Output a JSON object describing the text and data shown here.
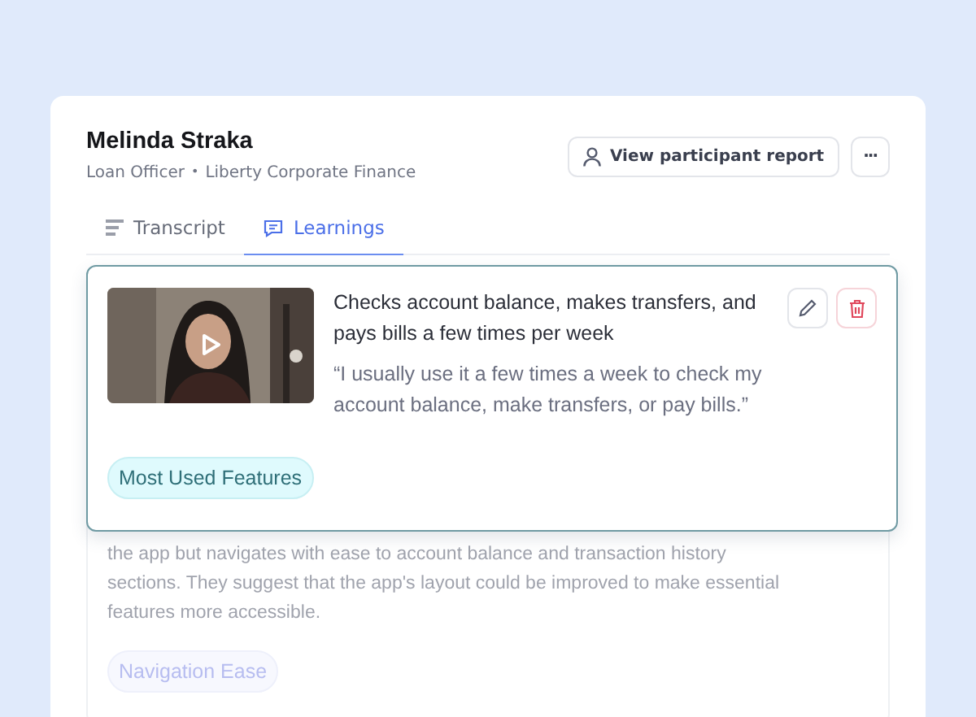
{
  "participant": {
    "name": "Melinda Straka",
    "role": "Loan Officer",
    "separator": "•",
    "company": "Liberty Corporate Finance"
  },
  "actions": {
    "report_button": "View participant report",
    "more_button": "···"
  },
  "tabs": [
    {
      "label": "Transcript",
      "selected": false,
      "kind": "transcript"
    },
    {
      "label": "Learnings",
      "selected": true,
      "kind": "learnings"
    }
  ],
  "learnings": [
    {
      "kind": "focused",
      "title": "Checks account balance, makes transfers, and pays bills a few times per week",
      "quote": "“I usually use it a few times a week to check my account balance, make transfers, or pay bills.”",
      "tag": "Most Used Features"
    },
    {
      "kind": "faded",
      "summary": "the app but navigates with ease to account balance and transaction history sections. They suggest that the app's layout could be improved to make essential features more accessible.",
      "tag": "Navigation Ease"
    }
  ]
}
